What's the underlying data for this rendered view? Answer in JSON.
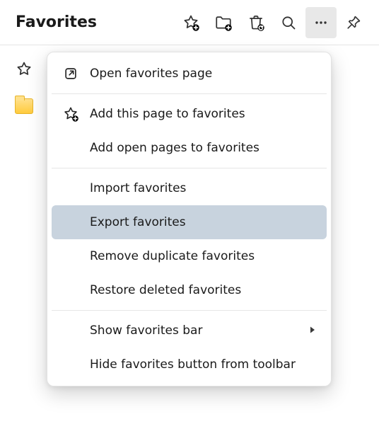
{
  "header": {
    "title": "Favorites"
  },
  "menu": {
    "open_page": "Open favorites page",
    "add_this_page": "Add this page to favorites",
    "add_open_pages": "Add open pages to favorites",
    "import": "Import favorites",
    "export": "Export favorites",
    "remove_duplicate": "Remove duplicate favorites",
    "restore_deleted": "Restore deleted favorites",
    "show_bar": "Show favorites bar",
    "hide_button": "Hide favorites button from toolbar"
  }
}
